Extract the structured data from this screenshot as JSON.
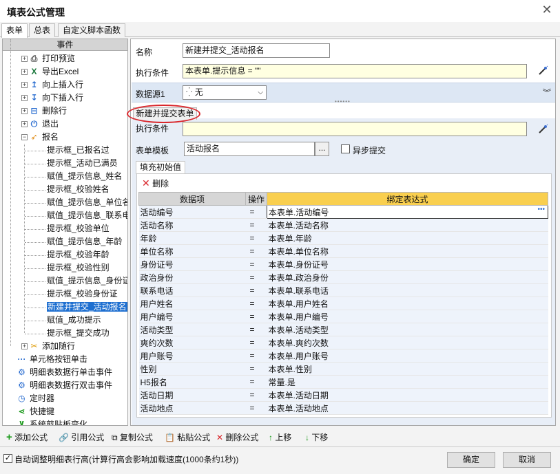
{
  "window": {
    "title": "填表公式管理",
    "close_glyph": "✕"
  },
  "tabs": [
    {
      "label": "表单",
      "active": true
    },
    {
      "label": "总表",
      "active": false
    },
    {
      "label": "自定义脚本函数",
      "active": false
    }
  ],
  "left_panel": {
    "header": "事件",
    "items": [
      {
        "label": "打印预览",
        "icon": "print-icon"
      },
      {
        "label": "导出Excel",
        "icon": "excel-icon"
      },
      {
        "label": "向上插入行",
        "icon": "insert-row-up-icon"
      },
      {
        "label": "向下插入行",
        "icon": "insert-row-down-icon"
      },
      {
        "label": "删除行",
        "icon": "delete-row-icon"
      },
      {
        "label": "退出",
        "icon": "power-icon"
      },
      {
        "label": "报名",
        "icon": "rocket-icon"
      },
      {
        "label": "提示框_已报名过"
      },
      {
        "label": "提示框_活动已满员"
      },
      {
        "label": "赋值_提示信息_姓名"
      },
      {
        "label": "提示框_校验姓名"
      },
      {
        "label": "赋值_提示信息_单位名"
      },
      {
        "label": "赋值_提示信息_联系电"
      },
      {
        "label": "提示框_校验单位"
      },
      {
        "label": "赋值_提示信息_年龄"
      },
      {
        "label": "提示框_校验年龄"
      },
      {
        "label": "提示框_校验性别"
      },
      {
        "label": "赋值_提示信息_身份证"
      },
      {
        "label": "提示框_校验身份证"
      },
      {
        "label": "新建并提交_活动报名"
      },
      {
        "label": "赋值_成功提示"
      },
      {
        "label": "提示框_提交成功"
      },
      {
        "label": "添加随行",
        "icon": "tools-icon"
      },
      {
        "label": "单元格按钮单击",
        "icon": "dots-icon"
      },
      {
        "label": "明细表数据行单击事件",
        "icon": "gear-icon"
      },
      {
        "label": "明细表数据行双击事件",
        "icon": "gear-icon"
      },
      {
        "label": "定时器",
        "icon": "timer-icon"
      },
      {
        "label": "快捷键",
        "icon": "share-icon"
      },
      {
        "label": "系统剪贴板变化",
        "icon": "clipboard-icon"
      }
    ]
  },
  "form": {
    "name_label": "名称",
    "name_value": "新建并提交_活动报名",
    "cond_label": "执行条件",
    "cond_value": "本表单.提示信息  = \"\"",
    "datasource_label": "数据源1",
    "datasource_value": "无",
    "section_tab": "新建并提交表单",
    "cond2_label": "执行条件",
    "cond2_value": "",
    "template_label": "表单模板",
    "template_value": "活动报名",
    "browse_label": "...",
    "async_label": "异步提交",
    "async_checked": false
  },
  "grid": {
    "tab": "填充初始值",
    "delete_label": "删除",
    "headers": [
      "数据项",
      "操作",
      "绑定表达式"
    ],
    "rows": [
      [
        "活动编号",
        "=",
        "本表单.活动编号"
      ],
      [
        "活动名称",
        "=",
        "本表单.活动名称"
      ],
      [
        "年龄",
        "=",
        "本表单.年龄"
      ],
      [
        "单位名称",
        "=",
        "本表单.单位名称"
      ],
      [
        "身份证号",
        "=",
        "本表单.身份证号"
      ],
      [
        "政治身份",
        "=",
        "本表单.政治身份"
      ],
      [
        "联系电话",
        "=",
        "本表单.联系电话"
      ],
      [
        "用户姓名",
        "=",
        "本表单.用户姓名"
      ],
      [
        "用户编号",
        "=",
        "本表单.用户编号"
      ],
      [
        "活动类型",
        "=",
        "本表单.活动类型"
      ],
      [
        "爽约次数",
        "=",
        "本表单.爽约次数"
      ],
      [
        "用户账号",
        "=",
        "本表单.用户账号"
      ],
      [
        "性别",
        "=",
        "本表单.性别"
      ],
      [
        "H5报名",
        "=",
        "常量.是"
      ],
      [
        "活动日期",
        "=",
        "本表单.活动日期"
      ],
      [
        "活动地点",
        "=",
        "本表单.活动地点"
      ]
    ]
  },
  "toolbar": {
    "add": "添加公式",
    "ref": "引用公式",
    "copy": "复制公式",
    "paste": "粘贴公式",
    "del": "删除公式",
    "up": "上移",
    "down": "下移"
  },
  "footer": {
    "auto_adjust": "自动调整明细表行高(计算行高会影响加载速度(1000条约1秒))",
    "auto_adjust_checked": true,
    "ok": "确定",
    "cancel": "取消"
  },
  "colors": {
    "accent": "#1e6fd0",
    "highlight_header": "#f9cf4f",
    "yellow_input": "#ffffe1",
    "red_oval": "#d9262b"
  }
}
